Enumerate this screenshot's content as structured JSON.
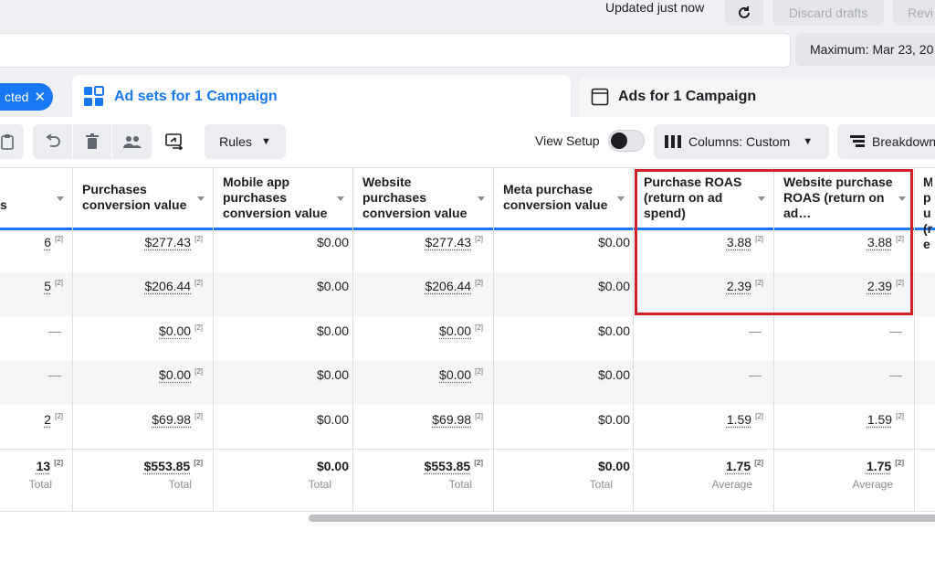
{
  "topbar": {
    "updated_text": "Updated just now",
    "discard_label": "Discard drafts",
    "review_label": "Revi"
  },
  "date_range": {
    "label": "Maximum: Mar 23, 20"
  },
  "selection": {
    "label": "cted"
  },
  "tabs": [
    {
      "label": "Ad sets for 1 Campaign",
      "active": true
    },
    {
      "label": "Ads for 1 Campaign",
      "active": false
    }
  ],
  "toolbar": {
    "rules_label": "Rules",
    "view_setup_label": "View Setup",
    "columns_label": "Columns: Custom",
    "breakdown_label": "Breakdown"
  },
  "table": {
    "headers": [
      "s",
      "Purchases conversion value",
      "Mobile app purchases conversion value",
      "Website purchases conversion value",
      "Meta purchase conversion value",
      "Purchase ROAS (return on ad spend)",
      "Website purchase ROAS (return on ad…",
      "M pu (re"
    ],
    "rows": [
      [
        "6",
        "$277.43",
        "$0.00",
        "$277.43",
        "$0.00",
        "3.88",
        "3.88"
      ],
      [
        "5",
        "$206.44",
        "$0.00",
        "$206.44",
        "$0.00",
        "2.39",
        "2.39"
      ],
      [
        "—",
        "$0.00",
        "$0.00",
        "$0.00",
        "$0.00",
        "—",
        "—"
      ],
      [
        "—",
        "$0.00",
        "$0.00",
        "$0.00",
        "$0.00",
        "—",
        "—"
      ],
      [
        "2",
        "$69.98",
        "$0.00",
        "$69.98",
        "$0.00",
        "1.59",
        "1.59"
      ]
    ],
    "totals": [
      "13",
      "$553.85",
      "$0.00",
      "$553.85",
      "$0.00",
      "1.75",
      "1.75"
    ],
    "total_labels": [
      "Total",
      "Total",
      "Total",
      "Total",
      "Total",
      "Average",
      "Average"
    ],
    "footnote": "[2]"
  },
  "colors": {
    "accent": "#1877f2",
    "highlight_border": "#d0212b"
  }
}
